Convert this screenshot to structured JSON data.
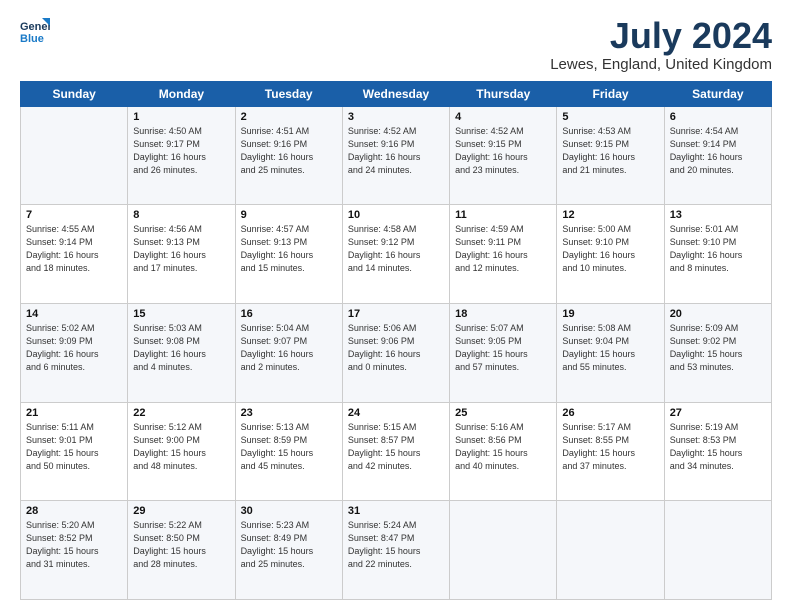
{
  "header": {
    "logo_line1": "General",
    "logo_line2": "Blue",
    "title": "July 2024",
    "subtitle": "Lewes, England, United Kingdom"
  },
  "days": [
    "Sunday",
    "Monday",
    "Tuesday",
    "Wednesday",
    "Thursday",
    "Friday",
    "Saturday"
  ],
  "weeks": [
    [
      {
        "date": "",
        "info": ""
      },
      {
        "date": "1",
        "info": "Sunrise: 4:50 AM\nSunset: 9:17 PM\nDaylight: 16 hours\nand 26 minutes."
      },
      {
        "date": "2",
        "info": "Sunrise: 4:51 AM\nSunset: 9:16 PM\nDaylight: 16 hours\nand 25 minutes."
      },
      {
        "date": "3",
        "info": "Sunrise: 4:52 AM\nSunset: 9:16 PM\nDaylight: 16 hours\nand 24 minutes."
      },
      {
        "date": "4",
        "info": "Sunrise: 4:52 AM\nSunset: 9:15 PM\nDaylight: 16 hours\nand 23 minutes."
      },
      {
        "date": "5",
        "info": "Sunrise: 4:53 AM\nSunset: 9:15 PM\nDaylight: 16 hours\nand 21 minutes."
      },
      {
        "date": "6",
        "info": "Sunrise: 4:54 AM\nSunset: 9:14 PM\nDaylight: 16 hours\nand 20 minutes."
      }
    ],
    [
      {
        "date": "7",
        "info": "Sunrise: 4:55 AM\nSunset: 9:14 PM\nDaylight: 16 hours\nand 18 minutes."
      },
      {
        "date": "8",
        "info": "Sunrise: 4:56 AM\nSunset: 9:13 PM\nDaylight: 16 hours\nand 17 minutes."
      },
      {
        "date": "9",
        "info": "Sunrise: 4:57 AM\nSunset: 9:13 PM\nDaylight: 16 hours\nand 15 minutes."
      },
      {
        "date": "10",
        "info": "Sunrise: 4:58 AM\nSunset: 9:12 PM\nDaylight: 16 hours\nand 14 minutes."
      },
      {
        "date": "11",
        "info": "Sunrise: 4:59 AM\nSunset: 9:11 PM\nDaylight: 16 hours\nand 12 minutes."
      },
      {
        "date": "12",
        "info": "Sunrise: 5:00 AM\nSunset: 9:10 PM\nDaylight: 16 hours\nand 10 minutes."
      },
      {
        "date": "13",
        "info": "Sunrise: 5:01 AM\nSunset: 9:10 PM\nDaylight: 16 hours\nand 8 minutes."
      }
    ],
    [
      {
        "date": "14",
        "info": "Sunrise: 5:02 AM\nSunset: 9:09 PM\nDaylight: 16 hours\nand 6 minutes."
      },
      {
        "date": "15",
        "info": "Sunrise: 5:03 AM\nSunset: 9:08 PM\nDaylight: 16 hours\nand 4 minutes."
      },
      {
        "date": "16",
        "info": "Sunrise: 5:04 AM\nSunset: 9:07 PM\nDaylight: 16 hours\nand 2 minutes."
      },
      {
        "date": "17",
        "info": "Sunrise: 5:06 AM\nSunset: 9:06 PM\nDaylight: 16 hours\nand 0 minutes."
      },
      {
        "date": "18",
        "info": "Sunrise: 5:07 AM\nSunset: 9:05 PM\nDaylight: 15 hours\nand 57 minutes."
      },
      {
        "date": "19",
        "info": "Sunrise: 5:08 AM\nSunset: 9:04 PM\nDaylight: 15 hours\nand 55 minutes."
      },
      {
        "date": "20",
        "info": "Sunrise: 5:09 AM\nSunset: 9:02 PM\nDaylight: 15 hours\nand 53 minutes."
      }
    ],
    [
      {
        "date": "21",
        "info": "Sunrise: 5:11 AM\nSunset: 9:01 PM\nDaylight: 15 hours\nand 50 minutes."
      },
      {
        "date": "22",
        "info": "Sunrise: 5:12 AM\nSunset: 9:00 PM\nDaylight: 15 hours\nand 48 minutes."
      },
      {
        "date": "23",
        "info": "Sunrise: 5:13 AM\nSunset: 8:59 PM\nDaylight: 15 hours\nand 45 minutes."
      },
      {
        "date": "24",
        "info": "Sunrise: 5:15 AM\nSunset: 8:57 PM\nDaylight: 15 hours\nand 42 minutes."
      },
      {
        "date": "25",
        "info": "Sunrise: 5:16 AM\nSunset: 8:56 PM\nDaylight: 15 hours\nand 40 minutes."
      },
      {
        "date": "26",
        "info": "Sunrise: 5:17 AM\nSunset: 8:55 PM\nDaylight: 15 hours\nand 37 minutes."
      },
      {
        "date": "27",
        "info": "Sunrise: 5:19 AM\nSunset: 8:53 PM\nDaylight: 15 hours\nand 34 minutes."
      }
    ],
    [
      {
        "date": "28",
        "info": "Sunrise: 5:20 AM\nSunset: 8:52 PM\nDaylight: 15 hours\nand 31 minutes."
      },
      {
        "date": "29",
        "info": "Sunrise: 5:22 AM\nSunset: 8:50 PM\nDaylight: 15 hours\nand 28 minutes."
      },
      {
        "date": "30",
        "info": "Sunrise: 5:23 AM\nSunset: 8:49 PM\nDaylight: 15 hours\nand 25 minutes."
      },
      {
        "date": "31",
        "info": "Sunrise: 5:24 AM\nSunset: 8:47 PM\nDaylight: 15 hours\nand 22 minutes."
      },
      {
        "date": "",
        "info": ""
      },
      {
        "date": "",
        "info": ""
      },
      {
        "date": "",
        "info": ""
      }
    ]
  ]
}
